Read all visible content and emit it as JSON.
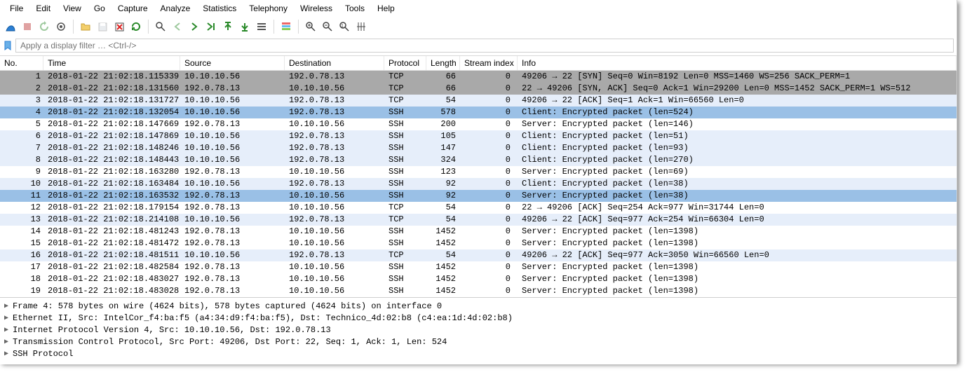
{
  "menu": {
    "items": [
      "File",
      "Edit",
      "View",
      "Go",
      "Capture",
      "Analyze",
      "Statistics",
      "Telephony",
      "Wireless",
      "Tools",
      "Help"
    ]
  },
  "filter": {
    "placeholder": "Apply a display filter … <Ctrl-/>"
  },
  "columns": {
    "no": "No.",
    "time": "Time",
    "src": "Source",
    "dst": "Destination",
    "proto": "Protocol",
    "len": "Length",
    "stream": "Stream index",
    "info": "Info"
  },
  "packets": [
    {
      "no": "1",
      "time": "2018-01-22 21:02:18.115339",
      "src": "10.10.10.56",
      "dst": "192.0.78.13",
      "proto": "TCP",
      "len": "66",
      "stream": "0",
      "info": "49206 → 22 [SYN] Seq=0 Win=8192 Len=0 MSS=1460 WS=256 SACK_PERM=1",
      "cls": "row-gray"
    },
    {
      "no": "2",
      "time": "2018-01-22 21:02:18.131560",
      "src": "192.0.78.13",
      "dst": "10.10.10.56",
      "proto": "TCP",
      "len": "66",
      "stream": "0",
      "info": "22 → 49206 [SYN, ACK] Seq=0 Ack=1 Win=29200 Len=0 MSS=1452 SACK_PERM=1 WS=512",
      "cls": "row-gray"
    },
    {
      "no": "3",
      "time": "2018-01-22 21:02:18.131727",
      "src": "10.10.10.56",
      "dst": "192.0.78.13",
      "proto": "TCP",
      "len": "54",
      "stream": "0",
      "info": "49206 → 22 [ACK] Seq=1 Ack=1 Win=66560 Len=0",
      "cls": "row-lightblue"
    },
    {
      "no": "4",
      "time": "2018-01-22 21:02:18.132054",
      "src": "10.10.10.56",
      "dst": "192.0.78.13",
      "proto": "SSH",
      "len": "578",
      "stream": "0",
      "info": "Client: Encrypted packet (len=524)",
      "cls": "row-selected"
    },
    {
      "no": "5",
      "time": "2018-01-22 21:02:18.147669",
      "src": "192.0.78.13",
      "dst": "10.10.10.56",
      "proto": "SSH",
      "len": "200",
      "stream": "0",
      "info": "Server: Encrypted packet (len=146)",
      "cls": "row-white"
    },
    {
      "no": "6",
      "time": "2018-01-22 21:02:18.147869",
      "src": "10.10.10.56",
      "dst": "192.0.78.13",
      "proto": "SSH",
      "len": "105",
      "stream": "0",
      "info": "Client: Encrypted packet (len=51)",
      "cls": "row-lightblue"
    },
    {
      "no": "7",
      "time": "2018-01-22 21:02:18.148246",
      "src": "10.10.10.56",
      "dst": "192.0.78.13",
      "proto": "SSH",
      "len": "147",
      "stream": "0",
      "info": "Client: Encrypted packet (len=93)",
      "cls": "row-lightblue"
    },
    {
      "no": "8",
      "time": "2018-01-22 21:02:18.148443",
      "src": "10.10.10.56",
      "dst": "192.0.78.13",
      "proto": "SSH",
      "len": "324",
      "stream": "0",
      "info": "Client: Encrypted packet (len=270)",
      "cls": "row-lightblue"
    },
    {
      "no": "9",
      "time": "2018-01-22 21:02:18.163280",
      "src": "192.0.78.13",
      "dst": "10.10.10.56",
      "proto": "SSH",
      "len": "123",
      "stream": "0",
      "info": "Server: Encrypted packet (len=69)",
      "cls": "row-white"
    },
    {
      "no": "10",
      "time": "2018-01-22 21:02:18.163484",
      "src": "10.10.10.56",
      "dst": "192.0.78.13",
      "proto": "SSH",
      "len": "92",
      "stream": "0",
      "info": "Client: Encrypted packet (len=38)",
      "cls": "row-lightblue"
    },
    {
      "no": "11",
      "time": "2018-01-22 21:02:18.163532",
      "src": "192.0.78.13",
      "dst": "10.10.10.56",
      "proto": "SSH",
      "len": "92",
      "stream": "0",
      "info": "Server: Encrypted packet (len=38)",
      "cls": "row-selected"
    },
    {
      "no": "12",
      "time": "2018-01-22 21:02:18.179154",
      "src": "192.0.78.13",
      "dst": "10.10.10.56",
      "proto": "TCP",
      "len": "54",
      "stream": "0",
      "info": "22 → 49206 [ACK] Seq=254 Ack=977 Win=31744 Len=0",
      "cls": "row-white"
    },
    {
      "no": "13",
      "time": "2018-01-22 21:02:18.214108",
      "src": "10.10.10.56",
      "dst": "192.0.78.13",
      "proto": "TCP",
      "len": "54",
      "stream": "0",
      "info": "49206 → 22 [ACK] Seq=977 Ack=254 Win=66304 Len=0",
      "cls": "row-lightblue"
    },
    {
      "no": "14",
      "time": "2018-01-22 21:02:18.481243",
      "src": "192.0.78.13",
      "dst": "10.10.10.56",
      "proto": "SSH",
      "len": "1452",
      "stream": "0",
      "info": "Server: Encrypted packet (len=1398)",
      "cls": "row-white"
    },
    {
      "no": "15",
      "time": "2018-01-22 21:02:18.481472",
      "src": "192.0.78.13",
      "dst": "10.10.10.56",
      "proto": "SSH",
      "len": "1452",
      "stream": "0",
      "info": "Server: Encrypted packet (len=1398)",
      "cls": "row-white"
    },
    {
      "no": "16",
      "time": "2018-01-22 21:02:18.481511",
      "src": "10.10.10.56",
      "dst": "192.0.78.13",
      "proto": "TCP",
      "len": "54",
      "stream": "0",
      "info": "49206 → 22 [ACK] Seq=977 Ack=3050 Win=66560 Len=0",
      "cls": "row-lightblue"
    },
    {
      "no": "17",
      "time": "2018-01-22 21:02:18.482584",
      "src": "192.0.78.13",
      "dst": "10.10.10.56",
      "proto": "SSH",
      "len": "1452",
      "stream": "0",
      "info": "Server: Encrypted packet (len=1398)",
      "cls": "row-white"
    },
    {
      "no": "18",
      "time": "2018-01-22 21:02:18.483027",
      "src": "192.0.78.13",
      "dst": "10.10.10.56",
      "proto": "SSH",
      "len": "1452",
      "stream": "0",
      "info": "Server: Encrypted packet (len=1398)",
      "cls": "row-white"
    },
    {
      "no": "19",
      "time": "2018-01-22 21:02:18.483028",
      "src": "192.0.78.13",
      "dst": "10.10.10.56",
      "proto": "SSH",
      "len": "1452",
      "stream": "0",
      "info": "Server: Encrypted packet (len=1398)",
      "cls": "row-white"
    }
  ],
  "details": {
    "lines": [
      "Frame 4: 578 bytes on wire (4624 bits), 578 bytes captured (4624 bits) on interface 0",
      "Ethernet II, Src: IntelCor_f4:ba:f5 (a4:34:d9:f4:ba:f5), Dst: Technico_4d:02:b8 (c4:ea:1d:4d:02:b8)",
      "Internet Protocol Version 4, Src: 10.10.10.56, Dst: 192.0.78.13",
      "Transmission Control Protocol, Src Port: 49206, Dst Port: 22, Seq: 1, Ack: 1, Len: 524",
      "SSH Protocol"
    ]
  }
}
